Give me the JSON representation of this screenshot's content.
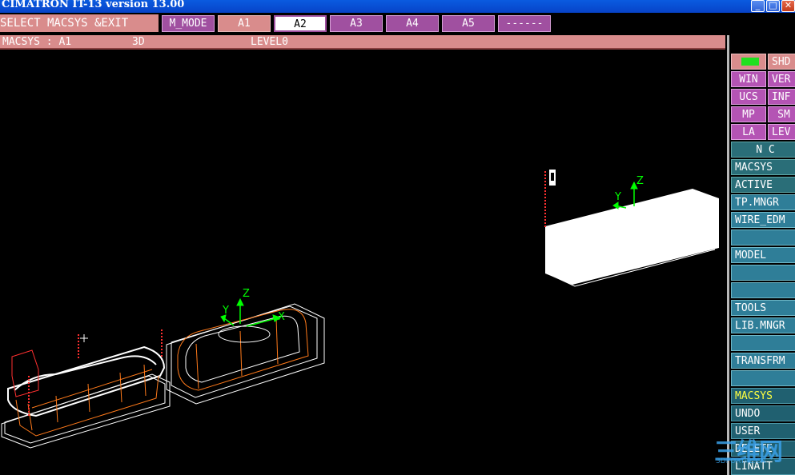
{
  "window": {
    "title": "CIMATRON IT-13 version 13.00",
    "minimize": "_",
    "maximize": "□",
    "close": "✕"
  },
  "prompt": "SELECT MACSYS &EXIT",
  "modes": [
    "M_MODE",
    "A1",
    "A2",
    "A3",
    "A4",
    "A5",
    "------"
  ],
  "status": {
    "macsys": "MACSYS : A1",
    "view": "3D",
    "level": "LEVEL0"
  },
  "viewport": {
    "axis_labels": {
      "z": "Z",
      "y": "Y",
      "x": "X"
    },
    "axis_color": "#00ff00",
    "wire_orange": "#ff7a1a",
    "wire_white": "#ffffff",
    "dot_red": "#ff3030"
  },
  "side": {
    "shd": "SHD",
    "win": "WIN",
    "ver": "VER",
    "ucs": "UCS",
    "inf": "INF",
    "mp": "MP",
    "sm": "SM",
    "la": "LA",
    "lev": "LEV",
    "nc": "N C",
    "macsys": "MACSYS",
    "active": "ACTIVE",
    "tpmngr": "TP.MNGR",
    "wireedm": "WIRE_EDM",
    "model": "MODEL",
    "tools": "TOOLS",
    "libmngr": "LIB.MNGR",
    "transfrm": "TRANSFRM",
    "macsys2": "MACSYS",
    "undo": "UNDO",
    "user": "USER",
    "delete": "DELETE",
    "linatt": "LINATT"
  },
  "watermark": {
    "logo": "三维网",
    "url": "3DPORTAL.CN"
  }
}
